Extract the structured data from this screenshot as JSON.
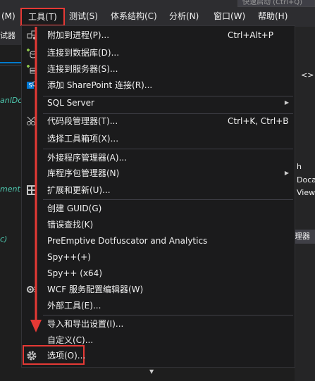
{
  "menubar": {
    "items": [
      "(M)",
      "工具(T)",
      "测试(S)",
      "体系结构(C)",
      "分析(N)",
      "窗口(W)",
      "帮助(H)"
    ],
    "search_hint": "快速启动 (Ctrl+Q)"
  },
  "left": {
    "toolstrip": "试器",
    "code_lines": [
      "anlDc",
      "ment",
      "c)"
    ]
  },
  "right": {
    "bracket": "<>",
    "texts": [
      "h",
      "Doca",
      "View"
    ],
    "button": "理器"
  },
  "tools_menu": {
    "items": [
      {
        "label": "附加到进程(P)...",
        "shortcut": "Ctrl+Alt+P",
        "icon": "attach-process-icon"
      },
      {
        "label": "连接到数据库(D)...",
        "shortcut": "",
        "icon": "connect-database-icon"
      },
      {
        "label": "连接到服务器(S)...",
        "shortcut": "",
        "icon": "connect-server-icon"
      },
      {
        "label": "添加 SharePoint 连接(R)...",
        "shortcut": "",
        "icon": "sharepoint-icon"
      },
      {
        "label": "SQL Server",
        "shortcut": "",
        "submenu": true
      },
      {
        "label": "代码段管理器(T)...",
        "shortcut": "Ctrl+K, Ctrl+B",
        "icon": "snippet-manager-icon"
      },
      {
        "label": "选择工具箱项(X)...",
        "shortcut": ""
      },
      {
        "label": "外接程序管理器(A)...",
        "shortcut": ""
      },
      {
        "label": "库程序包管理器(N)",
        "shortcut": "",
        "submenu": true
      },
      {
        "label": "扩展和更新(U)...",
        "shortcut": "",
        "icon": "extensions-icon"
      },
      {
        "label": "创建 GUID(G)",
        "shortcut": ""
      },
      {
        "label": "错误查找(K)",
        "shortcut": ""
      },
      {
        "label": "PreEmptive Dotfuscator and Analytics",
        "shortcut": ""
      },
      {
        "label": "Spy++(+)",
        "shortcut": ""
      },
      {
        "label": "Spy++ (x64)",
        "shortcut": ""
      },
      {
        "label": "WCF 服务配置编辑器(W)",
        "shortcut": "",
        "icon": "wcf-config-icon"
      },
      {
        "label": "外部工具(E)...",
        "shortcut": ""
      },
      {
        "label": "导入和导出设置(I)...",
        "shortcut": ""
      },
      {
        "label": "自定义(C)...",
        "shortcut": ""
      },
      {
        "label": "选项(O)...",
        "shortcut": "",
        "icon": "gear-icon"
      }
    ]
  },
  "colors": {
    "highlight_red": "#e53935",
    "menu_bg": "#1b1b1c",
    "menubar_bg": "#2d2d30",
    "accent_blue": "#007acc"
  }
}
